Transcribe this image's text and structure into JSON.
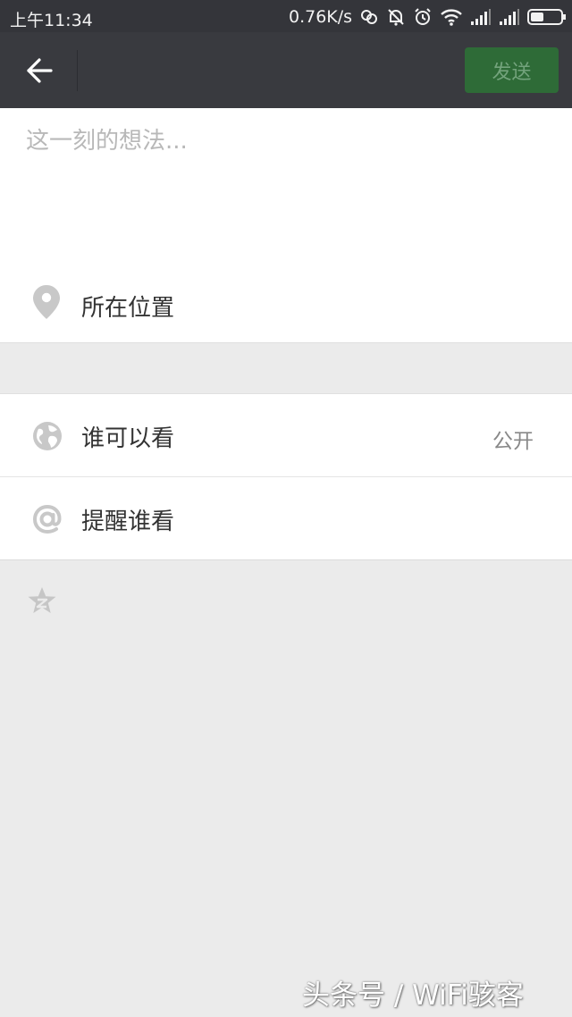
{
  "status_bar": {
    "time": "上午11:34",
    "speed": "0.76K/s",
    "icons": [
      "hd-link-icon",
      "mute-bell-icon",
      "alarm-icon",
      "wifi-icon",
      "signal-icon",
      "signal-icon",
      "battery-icon"
    ]
  },
  "toolbar": {
    "back_icon": "arrow-left-icon",
    "send_label": "发送"
  },
  "compose": {
    "placeholder": "这一刻的想法..."
  },
  "location": {
    "icon": "map-pin-icon",
    "label": "所在位置"
  },
  "visibility": {
    "icon": "globe-icon",
    "label": "谁可以看",
    "value": "公开"
  },
  "mention": {
    "icon": "at-sign-icon",
    "label": "提醒谁看"
  },
  "extra": {
    "icon": "star-icon"
  },
  "watermark": "头条号 / WiFi骇客",
  "colors": {
    "status_bar_bg": "#34353a",
    "toolbar_bg": "#393a3f",
    "send_button_bg": "#2e6b37",
    "page_bg": "#ebebeb"
  }
}
